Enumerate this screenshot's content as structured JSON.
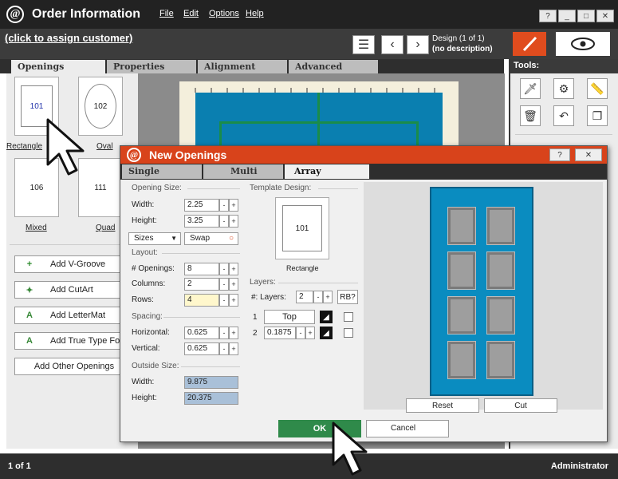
{
  "app": {
    "logo": "@",
    "title": "Order Information",
    "menu": [
      "File",
      "Edit",
      "Options",
      "Help"
    ],
    "window_buttons": [
      "?",
      "_",
      "□",
      "✕"
    ]
  },
  "subbar": {
    "customer_link": "(click to assign customer)",
    "design_line1": "Design  (1 of 1)",
    "design_line2": "(no description)"
  },
  "tabs": [
    "Openings",
    "Properties",
    "Alignment",
    "Advanced"
  ],
  "openings": [
    {
      "number": "101",
      "label": "Rectangle"
    },
    {
      "number": "102",
      "label": "Oval"
    },
    {
      "number": "106",
      "label": "Mixed"
    },
    {
      "number": "111",
      "label": "Quad"
    }
  ],
  "left_buttons": [
    "Add V-Groove",
    "Add CutArt",
    "Add LetterMat",
    "Add True Type Font",
    "Add Other Openings"
  ],
  "tools": {
    "label": "Tools:"
  },
  "status": {
    "left": "1 of 1",
    "right": "Administrator"
  },
  "dialog": {
    "logo": "@",
    "title": "New Openings",
    "title_buttons": [
      "?",
      "✕"
    ],
    "tabs": [
      "Single",
      "Multi",
      "Array"
    ],
    "opening_size": {
      "label": "Opening Size:",
      "width_label": "Width:",
      "width": "2.25",
      "height_label": "Height:",
      "height": "3.25",
      "sizes": "Sizes",
      "swap": "Swap"
    },
    "layout": {
      "label": "Layout:",
      "openings_label": "# Openings:",
      "openings": "8",
      "columns_label": "Columns:",
      "columns": "2",
      "rows_label": "Rows:",
      "rows": "4"
    },
    "spacing": {
      "label": "Spacing:",
      "horizontal_label": "Horizontal:",
      "horizontal": "0.625",
      "vertical_label": "Vertical:",
      "vertical": "0.625"
    },
    "outside_size": {
      "label": "Outside Size:",
      "width_label": "Width:",
      "width": "9.875",
      "height_label": "Height:",
      "height": "20.375"
    },
    "template": {
      "label": "Template Design:",
      "number": "101",
      "name": "Rectangle"
    },
    "layers": {
      "label": "Layers:",
      "count_label": "#: Layers:",
      "count": "2",
      "rb": "RB?",
      "layer1_num": "1",
      "layer1": "Top",
      "layer2_num": "2",
      "layer2": "0.1875"
    },
    "preview_buttons": [
      "Reset",
      "Cut"
    ],
    "ok": "OK",
    "cancel": "Cancel"
  },
  "colors": {
    "accent": "#d8431b",
    "mat": "#0a8cc0",
    "ok": "#2f8a4a"
  }
}
